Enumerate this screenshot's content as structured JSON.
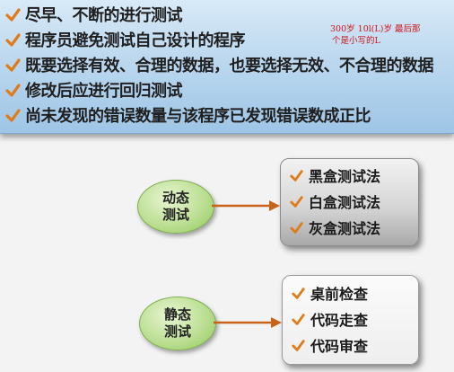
{
  "banner": {
    "bullets": [
      "尽早、不断的进行测试",
      "程序员避免测试自己设计的程序",
      "既要选择有效、合理的数据，也要选择无效、不合理的数据",
      "修改后应进行回归测试",
      "尚未发现的错误数量与该程序已发现错误数成正比"
    ],
    "note_line1": "300岁 10l(L)岁 最后那",
    "note_line2": "个是小写的L"
  },
  "dynamic": {
    "label": "动态测试",
    "items": [
      "黑盒测试法",
      "白盒测试法",
      "灰盒测试法"
    ]
  },
  "static": {
    "label": "静态测试",
    "items": [
      "桌前检查",
      "代码走查",
      "代码审查"
    ]
  },
  "colors": {
    "check": "#e07b1a",
    "arrow": "#c8641a",
    "note": "#d0141a"
  },
  "icons": [
    "check-icon",
    "arrow-right-icon"
  ]
}
